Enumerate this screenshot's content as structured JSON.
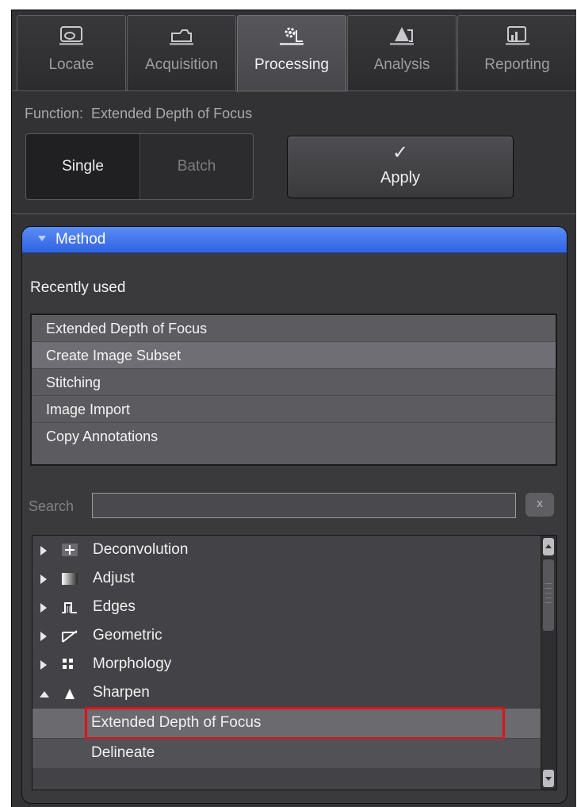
{
  "tabs": [
    {
      "label": "Locate",
      "icon": "locate-icon",
      "active": false
    },
    {
      "label": "Acquisition",
      "icon": "acquisition-icon",
      "active": false
    },
    {
      "label": "Processing",
      "icon": "processing-icon",
      "active": true
    },
    {
      "label": "Analysis",
      "icon": "analysis-icon",
      "active": false
    },
    {
      "label": "Reporting",
      "icon": "reporting-icon",
      "active": false
    }
  ],
  "function": {
    "label": "Function:",
    "value": "Extended Depth of Focus"
  },
  "mode": {
    "single": "Single",
    "batch": "Batch",
    "selected": "Single"
  },
  "apply": {
    "check": "✓",
    "label": "Apply"
  },
  "method": {
    "title": "Method",
    "recent_label": "Recently used",
    "recent": [
      "Extended Depth of Focus",
      "Create Image Subset",
      "Stitching",
      "Image Import",
      "Copy Annotations"
    ],
    "recent_selected": "Create Image Subset",
    "search": {
      "label": "Search",
      "value": "",
      "clear": "x"
    },
    "tree": [
      {
        "label": "Deconvolution",
        "icon": "deconvolution-icon",
        "expanded": false
      },
      {
        "label": "Adjust",
        "icon": "adjust-icon",
        "expanded": false
      },
      {
        "label": "Edges",
        "icon": "edges-icon",
        "expanded": false
      },
      {
        "label": "Geometric",
        "icon": "geometric-icon",
        "expanded": false
      },
      {
        "label": "Morphology",
        "icon": "morphology-icon",
        "expanded": false
      },
      {
        "label": "Sharpen",
        "icon": "sharpen-icon",
        "expanded": true
      }
    ],
    "sharpen_children": [
      "Extended Depth of Focus",
      "Delineate"
    ],
    "selected_child": "Extended Depth of Focus"
  },
  "colors": {
    "header_accent": "#3b6fe8",
    "highlight_box": "#e0121b"
  }
}
